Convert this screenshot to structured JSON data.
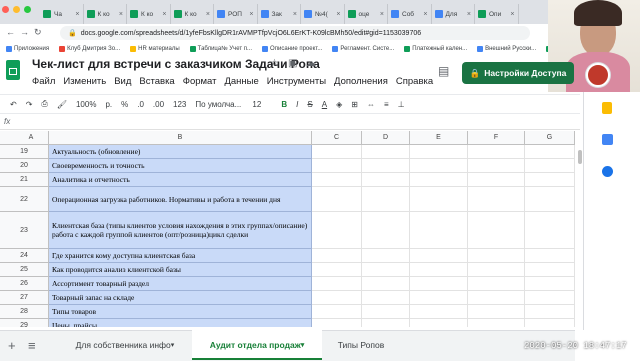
{
  "browser": {
    "tabs": [
      {
        "label": "Ча",
        "color": "#0f9d58"
      },
      {
        "label": "К ко",
        "color": "#0f9d58"
      },
      {
        "label": "К ко",
        "color": "#0f9d58"
      },
      {
        "label": "К ко",
        "color": "#0f9d58"
      },
      {
        "label": "РОП",
        "color": "#4285f4"
      },
      {
        "label": "Зак",
        "color": "#4285f4"
      },
      {
        "label": "№4(",
        "color": "#4285f4"
      },
      {
        "label": "оце",
        "color": "#0f9d58"
      },
      {
        "label": "Соб",
        "color": "#4285f4"
      },
      {
        "label": "Для",
        "color": "#4285f4"
      },
      {
        "label": "Опи",
        "color": "#0f9d58"
      }
    ],
    "url": "docs.google.com/spreadsheets/d/1yfeFbsKllgDR1rAVMPTfpVcjO6L6ErKT-K09lcBMh50/edit#gid=1153039706",
    "bookmarks": [
      {
        "label": "Приложения",
        "color": "#4285f4"
      },
      {
        "label": "Клуб Дмитрия Зо...",
        "color": "#ea4335"
      },
      {
        "label": "HR материалы",
        "color": "#fbbc04"
      },
      {
        "label": "Таблица№ Учет п...",
        "color": "#0f9d58"
      },
      {
        "label": "Описание проект...",
        "color": "#4285f4"
      },
      {
        "label": "Регламент. Систе...",
        "color": "#4285f4"
      },
      {
        "label": "Платежный кален...",
        "color": "#0f9d58"
      },
      {
        "label": "Внешний Русски...",
        "color": "#4285f4"
      },
      {
        "label": "Платежный кален...",
        "color": "#0f9d58"
      }
    ]
  },
  "doc": {
    "title": "Чек-лист для встречи с заказчиком Задачи Ропа",
    "menu": [
      "Файл",
      "Изменить",
      "Вид",
      "Вставка",
      "Формат",
      "Данные",
      "Инструменты",
      "Дополнения",
      "Справка"
    ],
    "share_label": "Настройки Доступа"
  },
  "toolbar": {
    "zoom": "100%",
    "currency": "р.",
    "percent": "%",
    "decimals_less": ".0",
    "decimals_more": ".00",
    "number_format": "123",
    "font": "По умолча...",
    "font_size": "12",
    "bold": "B",
    "italic": "I",
    "strike": "S",
    "text_color": "A"
  },
  "formula_bar": {
    "fx": "fx"
  },
  "columns": [
    "A",
    "B",
    "C",
    "D",
    "E",
    "F",
    "G"
  ],
  "rows": [
    {
      "n": "19",
      "b": "Актуальность (обновление)",
      "h": 1
    },
    {
      "n": "20",
      "b": "Своевременность и точность",
      "h": 1
    },
    {
      "n": "21",
      "b": "Аналитика и отчетность",
      "h": 1
    },
    {
      "n": "22",
      "b": "Операционная загрузка работников. Нормативы и работа в течении дня",
      "h": 2
    },
    {
      "n": "23",
      "b": "Клиентская база (типы клиентов условия нахождения в этих группах/описание) работа с каждой группой клиентов (опт/розница)цикл сделки",
      "h": 3
    },
    {
      "n": "24",
      "b": "Где хранится кому доступна клиентская база",
      "h": 1
    },
    {
      "n": "25",
      "b": "Как проводится анализ клиентской базы",
      "h": 1
    },
    {
      "n": "26",
      "b": "Ассортимент товарный раздел",
      "h": 1
    },
    {
      "n": "27",
      "b": "Товарный запас на складе",
      "h": 1
    },
    {
      "n": "28",
      "b": "Типы товаров",
      "h": 1
    },
    {
      "n": "29",
      "b": "Цены, прайсы",
      "h": 1
    }
  ],
  "sheets": {
    "tabs": [
      {
        "label": "Для собственника инфо",
        "active": false
      },
      {
        "label": "Аудит отдела продаж",
        "active": true
      },
      {
        "label": "Типы Ропов",
        "active": false
      }
    ]
  },
  "timestamp": "2020-05-20  18:47:17"
}
